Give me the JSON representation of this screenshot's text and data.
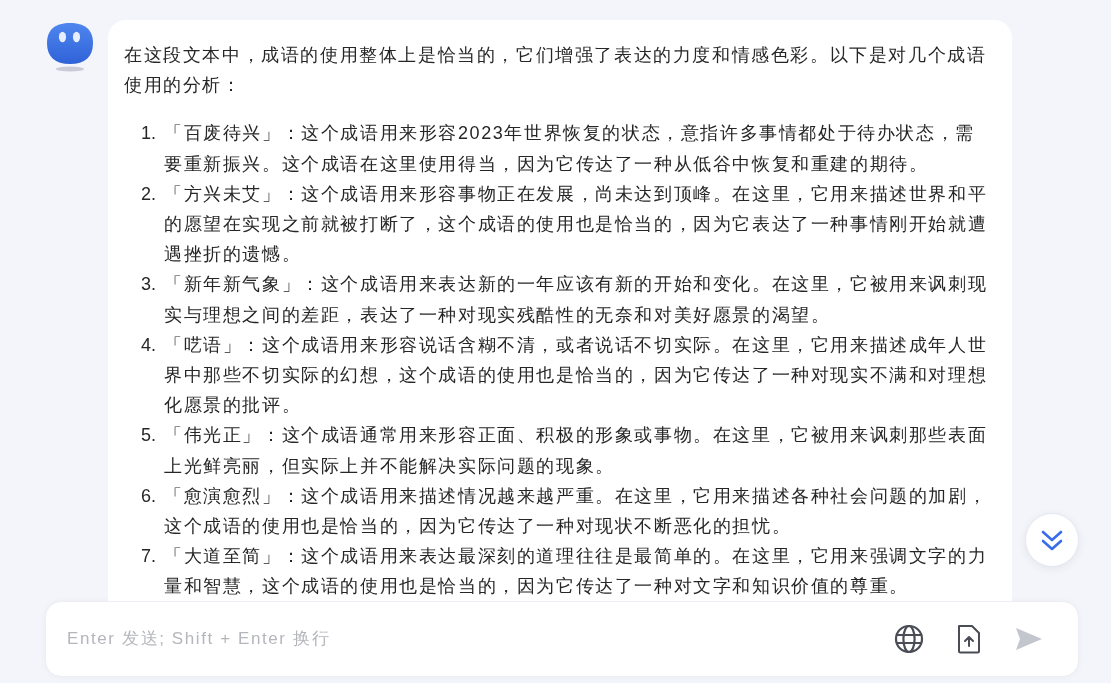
{
  "assistant_message": {
    "intro": "在这段文本中，成语的使用整体上是恰当的，它们增强了表达的力度和情感色彩。以下是对几个成语使用的分析：",
    "items": [
      {
        "number": "1.",
        "text": "「百废待兴」：这个成语用来形容2023年世界恢复的状态，意指许多事情都处于待办状态，需要重新振兴。这个成语在这里使用得当，因为它传达了一种从低谷中恢复和重建的期待。"
      },
      {
        "number": "2.",
        "text": "「方兴未艾」：这个成语用来形容事物正在发展，尚未达到顶峰。在这里，它用来描述世界和平的愿望在实现之前就被打断了，这个成语的使用也是恰当的，因为它表达了一种事情刚开始就遭遇挫折的遗憾。"
      },
      {
        "number": "3.",
        "text": "「新年新气象」：这个成语用来表达新的一年应该有新的开始和变化。在这里，它被用来讽刺现实与理想之间的差距，表达了一种对现实残酷性的无奈和对美好愿景的渴望。"
      },
      {
        "number": "4.",
        "text": "「呓语」：这个成语用来形容说话含糊不清，或者说话不切实际。在这里，它用来描述成年人世界中那些不切实际的幻想，这个成语的使用也是恰当的，因为它传达了一种对现实不满和对理想化愿景的批评。"
      },
      {
        "number": "5.",
        "text": "「伟光正」：这个成语通常用来形容正面、积极的形象或事物。在这里，它被用来讽刺那些表面上光鲜亮丽，但实际上并不能解决实际问题的现象。"
      },
      {
        "number": "6.",
        "text": "「愈演愈烈」：这个成语用来描述情况越来越严重。在这里，它用来描述各种社会问题的加剧，这个成语的使用也是恰当的，因为它传达了一种对现状不断恶化的担忧。"
      },
      {
        "number": "7.",
        "text": "「大道至简」：这个成语用来表达最深刻的道理往往是最简单的。在这里，它用来强调文字的力量和智慧，这个成语的使用也是恰当的，因为它传达了一种对文字和知识价值的尊重。"
      }
    ]
  },
  "composer": {
    "placeholder": "Enter 发送; Shift + Enter 换行",
    "send_button": {
      "disabled": true
    }
  }
}
